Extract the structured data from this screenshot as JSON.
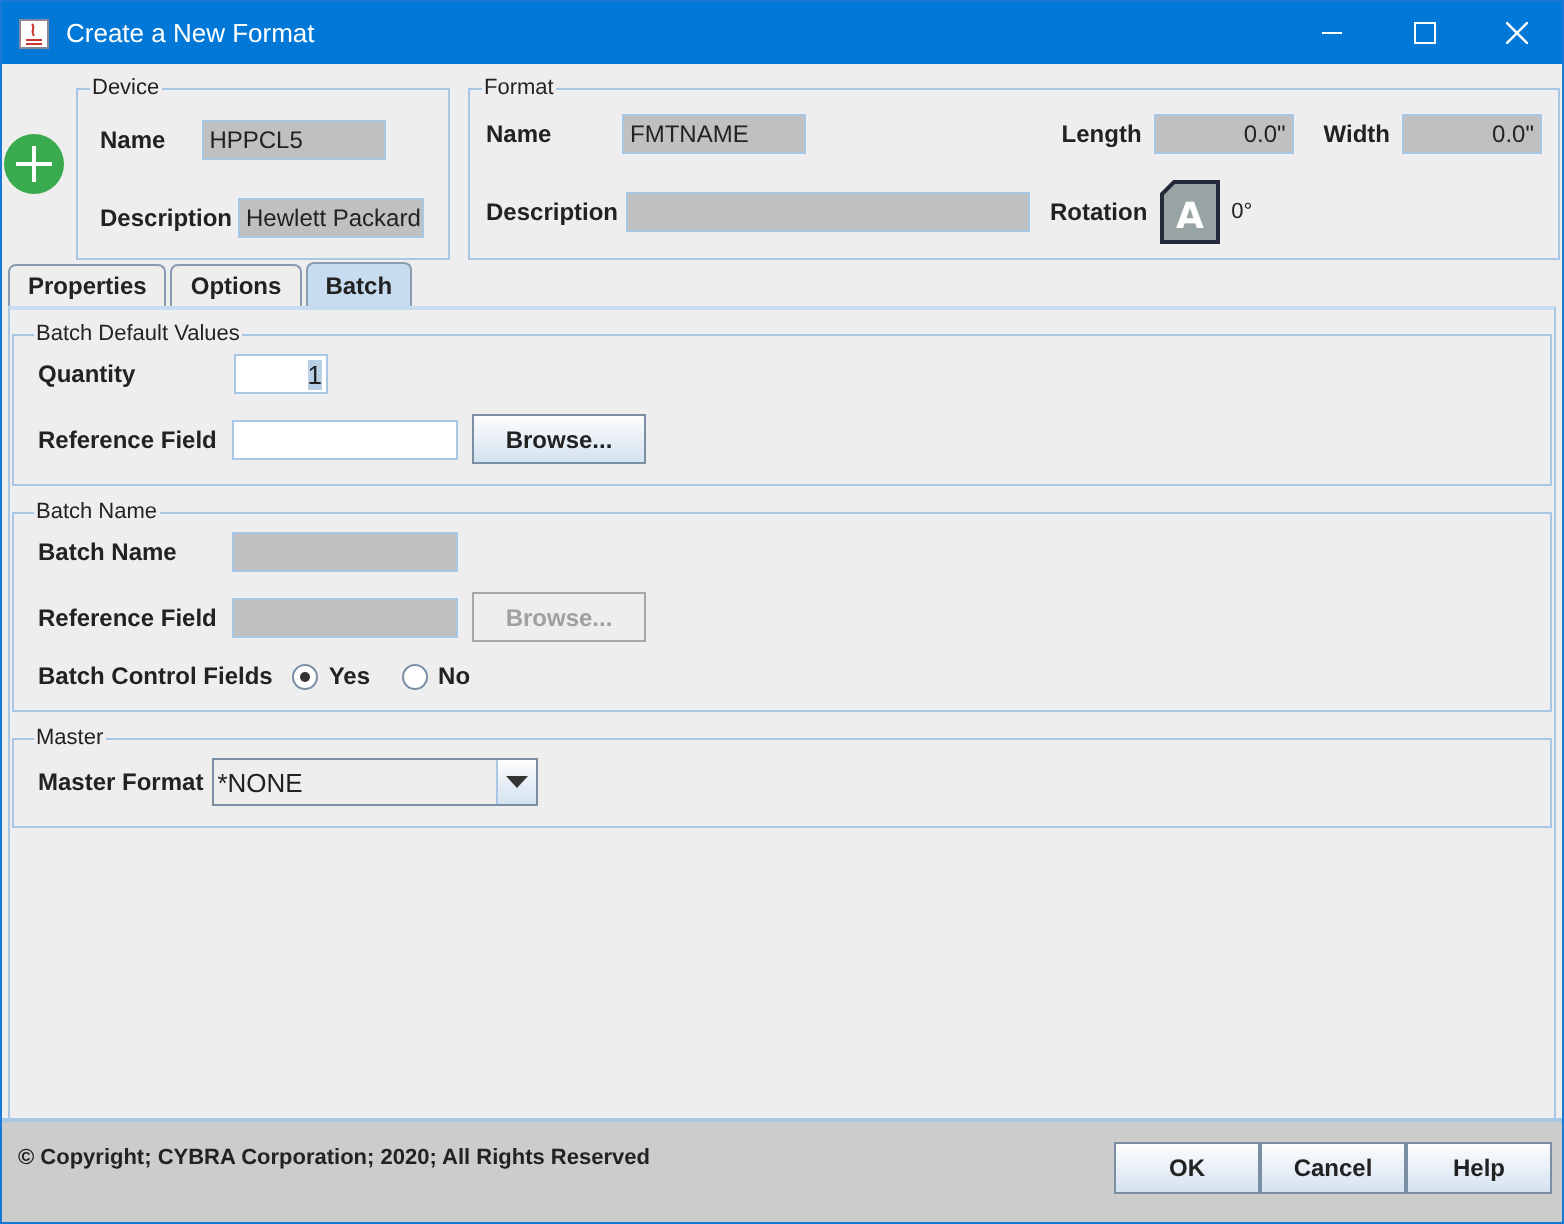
{
  "window": {
    "title": "Create a New Format"
  },
  "device": {
    "legend": "Device",
    "fields": [
      {
        "label": "Name",
        "value": "HPPCL5"
      },
      {
        "label": "Description",
        "value": "Hewlett Packard"
      }
    ]
  },
  "format": {
    "legend": "Format",
    "name": {
      "label": "Name",
      "value": "FMTNAME"
    },
    "description": {
      "label": "Description"
    },
    "length": {
      "label": "Length",
      "value": "0.0\""
    },
    "width": {
      "label": "Width",
      "value": "0.0\""
    },
    "rotation": {
      "label": "Rotation",
      "glyph": "A",
      "angle": "0°"
    }
  },
  "tabs": [
    {
      "label": "Properties",
      "selected": false
    },
    {
      "label": "Options",
      "selected": false
    },
    {
      "label": "Batch",
      "selected": true
    }
  ],
  "groups": [
    {
      "legend": "Batch Default Values",
      "rows": [
        {
          "kind": "number",
          "label": "Quantity",
          "value": "1",
          "disabled": false
        },
        {
          "kind": "text",
          "label": "Reference Field",
          "disabled": false,
          "button": {
            "label": "Browse...",
            "disabled": false
          }
        }
      ]
    },
    {
      "legend": "Batch Name",
      "rows": [
        {
          "kind": "text",
          "label": "Batch Name",
          "disabled": true
        },
        {
          "kind": "text",
          "label": "Reference Field",
          "disabled": true,
          "button": {
            "label": "Browse...",
            "disabled": true
          }
        },
        {
          "kind": "radio",
          "label": "Batch Control Fields",
          "options": [
            {
              "label": "Yes",
              "selected": true
            },
            {
              "label": "No",
              "selected": false
            }
          ]
        }
      ]
    },
    {
      "legend": "Master",
      "rows": [
        {
          "kind": "combo",
          "label": "Master Format",
          "value": "*NONE"
        }
      ]
    }
  ],
  "footer": {
    "copyright": "© Copyright; CYBRA Corporation; 2020; All Rights Reserved",
    "buttons": [
      "OK",
      "Cancel",
      "Help"
    ]
  }
}
